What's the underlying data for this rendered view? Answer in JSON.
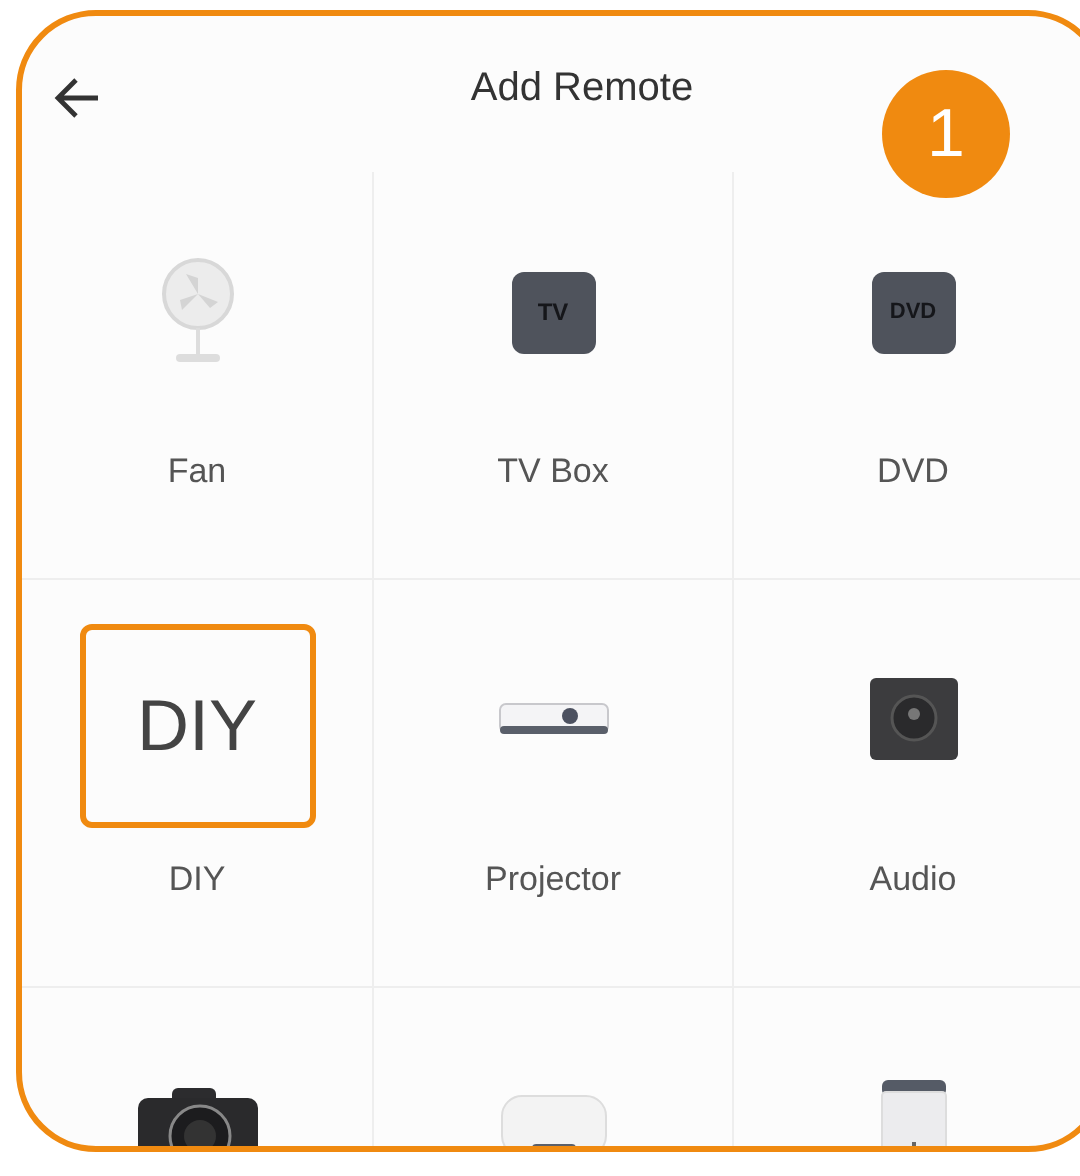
{
  "header": {
    "title": "Add Remote"
  },
  "callout": {
    "number": "1"
  },
  "devices": [
    {
      "kind": "fan",
      "label": "Fan",
      "highlighted": false
    },
    {
      "kind": "tv-box",
      "label": "TV Box",
      "icon_text": "TV",
      "highlighted": false
    },
    {
      "kind": "dvd",
      "label": "DVD",
      "icon_text": "DVD",
      "highlighted": false
    },
    {
      "kind": "diy",
      "label": "DIY",
      "icon_text": "DIY",
      "highlighted": true
    },
    {
      "kind": "projector",
      "label": "Projector",
      "highlighted": false
    },
    {
      "kind": "audio",
      "label": "Audio",
      "highlighted": false
    },
    {
      "kind": "camera",
      "highlighted": false
    },
    {
      "kind": "heater",
      "highlighted": false
    },
    {
      "kind": "dehumidifier",
      "highlighted": false
    }
  ]
}
